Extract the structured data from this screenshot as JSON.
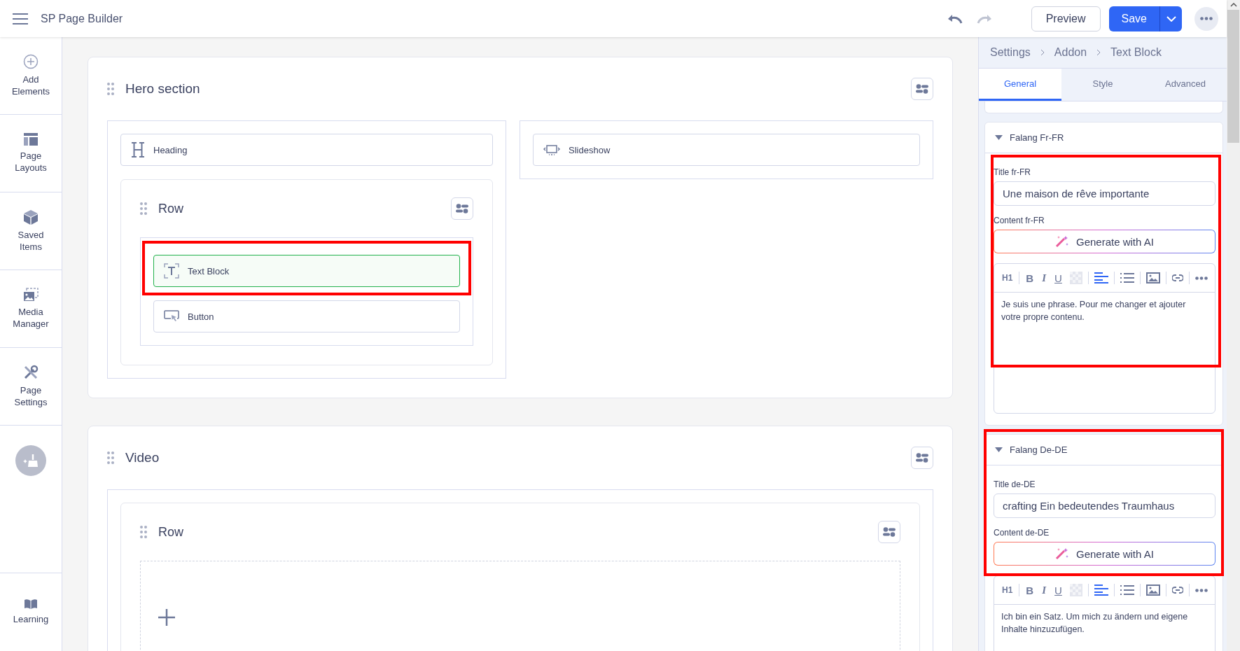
{
  "app": {
    "title": "SP Page Builder"
  },
  "toolbar": {
    "preview": "Preview",
    "save": "Save"
  },
  "sidebar": {
    "items": [
      {
        "label": "Add Elements"
      },
      {
        "label": "Page Layouts"
      },
      {
        "label": "Saved Items"
      },
      {
        "label": "Media Manager"
      },
      {
        "label": "Page Settings"
      }
    ],
    "bottom": {
      "label": "Learning"
    }
  },
  "sections": [
    {
      "title": "Hero section",
      "columns": [
        {
          "items": [
            {
              "kind": "heading",
              "label": "Heading",
              "selected": false,
              "highlighted": false
            },
            {
              "kind": "row",
              "title": "Row",
              "items": [
                {
                  "kind": "text",
                  "label": "Text Block",
                  "selected": true,
                  "highlighted": true
                },
                {
                  "kind": "button",
                  "label": "Button",
                  "selected": false,
                  "highlighted": false
                }
              ]
            }
          ]
        },
        {
          "items": [
            {
              "kind": "slideshow",
              "label": "Slideshow",
              "selected": false,
              "highlighted": false
            }
          ]
        }
      ]
    },
    {
      "title": "Video",
      "columns": [
        {
          "items": [
            {
              "kind": "row",
              "title": "Row"
            }
          ]
        }
      ]
    }
  ],
  "panel": {
    "breadcrumb": [
      "Settings",
      "Addon",
      "Text Block"
    ],
    "tabs": [
      {
        "label": "General",
        "selected": true
      },
      {
        "label": "Style",
        "selected": false
      },
      {
        "label": "Advanced",
        "selected": false
      }
    ],
    "groups": [
      {
        "title": "Falang Fr-FR",
        "expanded": true,
        "highlighted": true,
        "title_label": "Title fr-FR",
        "title_value": "Une maison de rêve importante",
        "content_label": "Content fr-FR",
        "generate": "Generate with AI",
        "format_buttons": [
          "H1",
          "B",
          "I",
          "U"
        ],
        "content": "Je suis une phrase. Pour me changer et ajouter votre propre contenu."
      },
      {
        "title": "Falang De-DE",
        "expanded": true,
        "highlighted": true,
        "title_label": "Title de-DE",
        "title_value": "crafting Ein bedeutendes Traumhaus",
        "content_label": "Content de-DE",
        "generate": "Generate with AI",
        "format_buttons": [
          "H1",
          "B",
          "I",
          "U"
        ],
        "content": "Ich bin ein Satz. Um mich zu ändern und eigene Inhalte hinzuzufügen."
      }
    ]
  }
}
